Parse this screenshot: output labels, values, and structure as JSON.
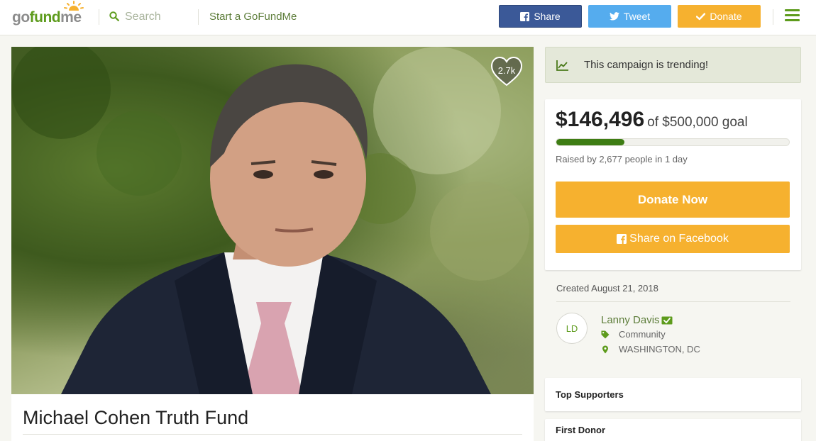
{
  "header": {
    "logo": {
      "go": "go",
      "fund": "fund",
      "me": "me"
    },
    "search": {
      "placeholder": "Search"
    },
    "start_link": "Start a GoFundMe",
    "share_label": "Share",
    "tweet_label": "Tweet",
    "donate_label": "Donate",
    "icons": [
      "search-icon",
      "facebook-icon",
      "twitter-icon",
      "check-icon",
      "menu-icon"
    ]
  },
  "hero": {
    "heart_count": "2.7k",
    "photo": "portrait-photo"
  },
  "campaign": {
    "title": "Michael Cohen Truth Fund"
  },
  "trending": {
    "text": "This campaign is trending!"
  },
  "donation": {
    "raised_amount": "$146,496",
    "goal_text": "of $500,000 goal",
    "progress_fraction": 0.293,
    "raised_by": "Raised by 2,677 people in 1 day",
    "donate_now_label": "Donate Now",
    "share_facebook_label": "Share on Facebook"
  },
  "details": {
    "created": "Created August 21, 2018",
    "organizer_initials": "LD",
    "organizer_name": "Lanny Davis",
    "category": "Community",
    "location": "WASHINGTON, DC"
  },
  "supporters": {
    "top_title": "Top Supporters",
    "first_donor_title": "First Donor"
  },
  "colors": {
    "brand_green": "#5d9b1c",
    "facebook_blue": "#3b5998",
    "twitter_blue": "#55acee",
    "donate_orange": "#f6b12f",
    "progress_green": "#3e7d14"
  }
}
